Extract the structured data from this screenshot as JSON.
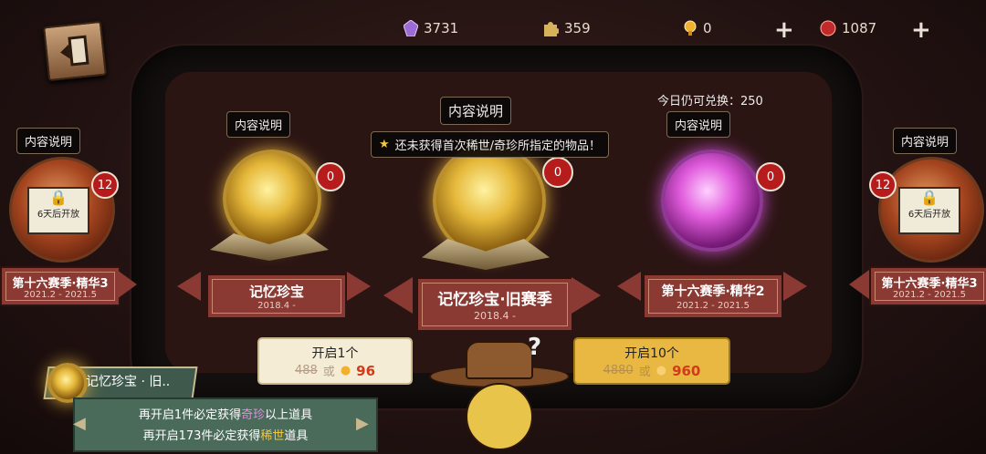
{
  "currencies": [
    {
      "icon": "purple-crystal-icon",
      "value": "3731",
      "color": "#9d6bd8"
    },
    {
      "icon": "puzzle-piece-icon",
      "value": "359",
      "color": "#d8b258"
    },
    {
      "icon": "gold-clue-icon",
      "value": "0",
      "color": "#f0b030"
    },
    {
      "icon": "red-gem-icon",
      "value": "1087",
      "color": "#c22a2a"
    }
  ],
  "content_info_label": "内容说明",
  "remaining_today": "今日仍可兑换：250",
  "tooltip_text": "还未获得首次稀世/奇珍所指定的物品！",
  "locked_text": "6天后开放",
  "cards": [
    {
      "title": "第十六赛季·精华3",
      "date": "2021.2 - 2021.5",
      "count": "12",
      "type": "locked"
    },
    {
      "title": "记忆珍宝",
      "date": "2018.4 -",
      "count": "0",
      "type": "gold"
    },
    {
      "title": "记忆珍宝·旧赛季",
      "date": "2018.4 -",
      "count": "0",
      "type": "gold"
    },
    {
      "title": "第十六赛季·精华2",
      "date": "2021.2 - 2021.5",
      "count": "0",
      "type": "purple"
    },
    {
      "title": "第十六赛季·精华3",
      "date": "2021.2 - 2021.5",
      "count": "12",
      "type": "locked"
    }
  ],
  "buttons": {
    "open1": {
      "label": "开启1个",
      "old_price": "488",
      "or": "或",
      "price": "96",
      "bg": "#f4ecd5"
    },
    "open10": {
      "label": "开启10个",
      "old_price": "4880",
      "or": "或",
      "price": "960",
      "bg": "#e8b843"
    }
  },
  "info_panel": {
    "title": "记忆珍宝 · 旧..",
    "line1_pre": "再开启1件必定获得",
    "line1_hl": "奇珍",
    "line1_post": "以上道具",
    "line2_pre": "再开启173件必定获得",
    "line2_hl": "稀世",
    "line2_post": "道具"
  }
}
